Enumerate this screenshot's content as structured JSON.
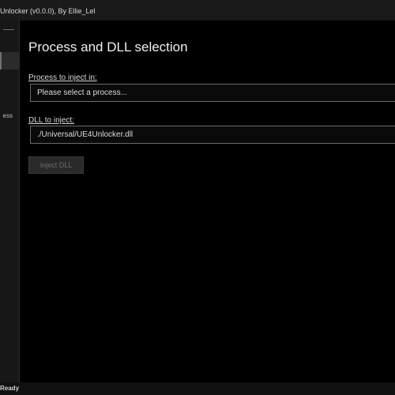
{
  "window": {
    "title": "Unlocker (v0.0.0), By Ellie_Lel"
  },
  "sidebar": {
    "item_label": "ess"
  },
  "main": {
    "title": "Process and DLL selection",
    "process_field": {
      "label": "Process to inject in:",
      "value": "Please select a process..."
    },
    "dll_field": {
      "label": "DLL to inject:",
      "value": "./Universal/UE4Unlocker.dll"
    },
    "inject_button_label": "Inject DLL"
  },
  "statusbar": {
    "text": "Ready"
  }
}
